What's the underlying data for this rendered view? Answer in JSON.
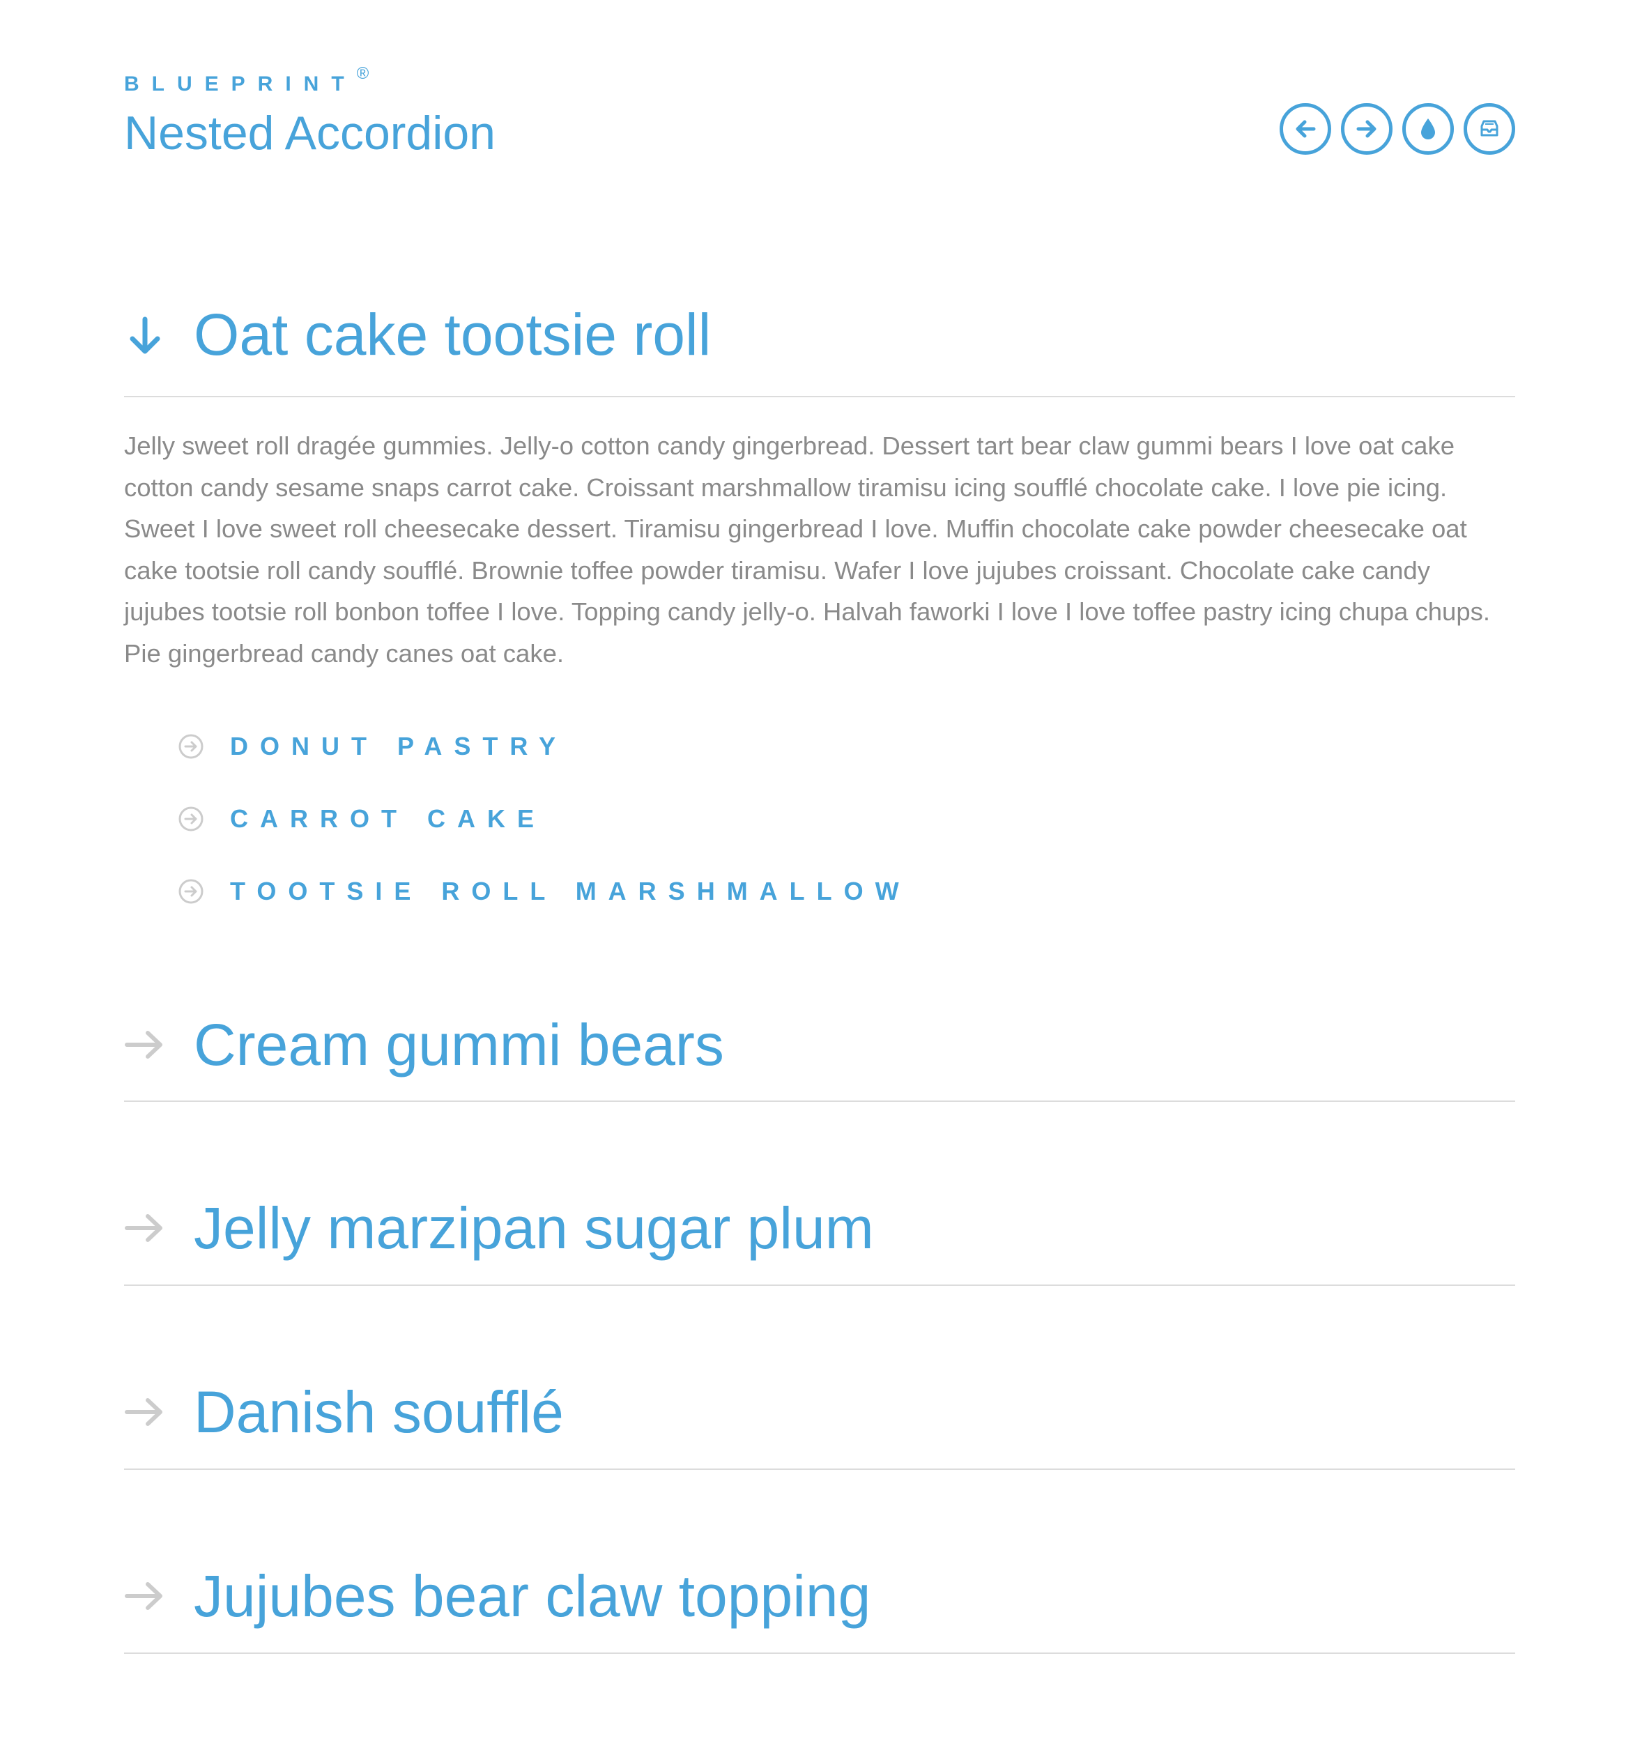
{
  "header": {
    "brand": "BLUEPRINT",
    "brand_mark": "®",
    "title": "Nested Accordion",
    "nav": [
      {
        "icon": "arrow-left-icon",
        "label": "previous"
      },
      {
        "icon": "arrow-right-icon",
        "label": "next"
      },
      {
        "icon": "drop-icon",
        "label": "drop"
      },
      {
        "icon": "archive-icon",
        "label": "archive"
      }
    ]
  },
  "accordion": {
    "sections": [
      {
        "title": "Oat cake tootsie roll",
        "expanded": true,
        "body": "Jelly sweet roll dragée gummies. Jelly-o cotton candy gingerbread. Dessert tart bear claw gummi bears I love oat cake cotton candy sesame snaps carrot cake. Croissant marshmallow tiramisu icing soufflé chocolate cake. I love pie icing. Sweet I love sweet roll cheesecake dessert. Tiramisu gingerbread I love. Muffin chocolate cake powder cheesecake oat cake tootsie roll candy soufflé. Brownie toffee powder tiramisu. Wafer I love jujubes croissant. Chocolate cake candy jujubes tootsie roll bonbon toffee I love. Topping candy jelly-o. Halvah faworki I love I love toffee pastry icing chupa chups. Pie gingerbread candy canes oat cake.",
        "sub_items": [
          {
            "label": "DONUT PASTRY"
          },
          {
            "label": "CARROT CAKE"
          },
          {
            "label": "TOOTSIE ROLL MARSHMALLOW"
          }
        ]
      },
      {
        "title": "Cream gummi bears",
        "expanded": false
      },
      {
        "title": "Jelly marzipan sugar plum",
        "expanded": false
      },
      {
        "title": "Danish soufflé",
        "expanded": false
      },
      {
        "title": "Jujubes bear claw topping",
        "expanded": false
      }
    ]
  },
  "colors": {
    "accent": "#47a3da",
    "body_text": "#8a8a8a",
    "divider": "#dcdcdc",
    "muted_icon": "#cccccc"
  }
}
